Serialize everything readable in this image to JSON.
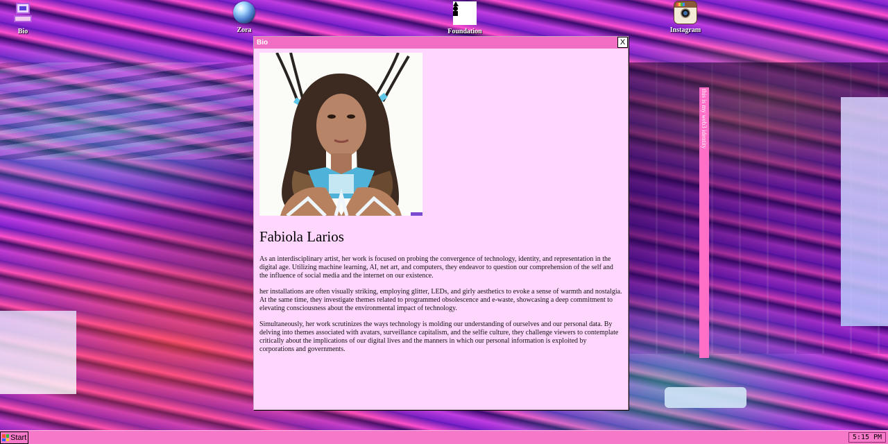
{
  "desktop_icons": [
    {
      "label": "Bio",
      "icon": "computer-icon"
    },
    {
      "label": "Zora",
      "icon": "zora-orb-icon"
    },
    {
      "label": "Foundation",
      "icon": "foundation-logo-icon"
    },
    {
      "label": "Instagram",
      "icon": "instagram-camera-icon"
    }
  ],
  "bio_window": {
    "title": "Bio",
    "close_label": "X",
    "name": "Fabiola Larios",
    "paragraphs": [
      "As an interdisciplinary artist, her work is focused on probing the convergence of technology, identity, and representation in the digital age. Utilizing machine learning, AI, net art, and computers, they endeavor to question our comprehension of the self and the influence of social media and the internet on our existence.",
      "her installations are often visually striking, employing glitter, LEDs, and girly aesthetics to evoke a sense of warmth and nostalgia. At the same time, they investigate themes related to programmed obsolescence and e-waste, showcasing a deep commitment to elevating consciousness about the environmental impact of technology.",
      "Simultaneously, her work scrutinizes the ways technology is molding our understanding of ourselves and our personal data. By delving into themes associated with avatars, surveillance capitalism, and the selfie culture, they challenge viewers to contemplate critically about the implications of our digital lives and the manners in which our personal information is exploited by corporations and governments."
    ]
  },
  "side_bar": {
    "text": "this is my web3 identity"
  },
  "taskbar": {
    "start_label": "Start",
    "clock": "5:15 PM"
  },
  "colors": {
    "titlebar": "#f06ec4",
    "window_bg": "#ffd6fd",
    "taskbar": "#f678c8",
    "side_bar": "#ff6fc8"
  }
}
